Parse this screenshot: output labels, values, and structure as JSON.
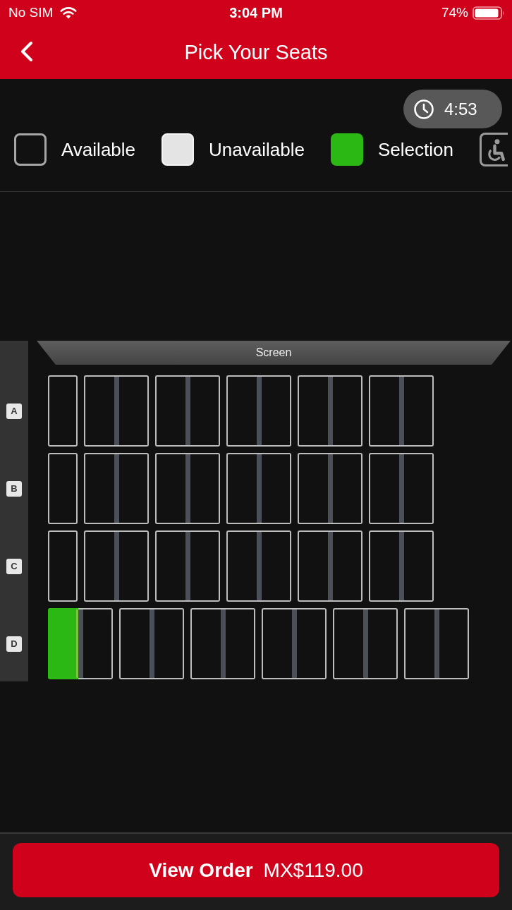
{
  "status_bar": {
    "carrier": "No SIM",
    "time": "3:04 PM",
    "battery": "74%"
  },
  "nav_bar": {
    "title": "Pick Your Seats"
  },
  "timer": {
    "time": "4:53"
  },
  "legend": [
    {
      "kind": "available",
      "label": "Available"
    },
    {
      "kind": "unavailable",
      "label": "Unavailable"
    },
    {
      "kind": "selection",
      "label": "Selection"
    },
    {
      "kind": "accessible"
    }
  ],
  "seat_map": {
    "screen_label": "Screen",
    "rows": [
      {
        "label": "A",
        "groups": [
          {
            "seats": [
              {
                "selected": false
              }
            ]
          },
          {
            "seats": [
              {
                "selected": false
              },
              {
                "selected": false
              }
            ]
          },
          {
            "seats": [
              {
                "selected": false
              },
              {
                "selected": false
              }
            ]
          },
          {
            "seats": [
              {
                "selected": false
              },
              {
                "selected": false
              }
            ]
          },
          {
            "seats": [
              {
                "selected": false
              },
              {
                "selected": false
              }
            ]
          },
          {
            "seats": [
              {
                "selected": false
              },
              {
                "selected": false
              }
            ]
          }
        ]
      },
      {
        "label": "B",
        "groups": [
          {
            "seats": [
              {
                "selected": false
              }
            ]
          },
          {
            "seats": [
              {
                "selected": false
              },
              {
                "selected": false
              }
            ]
          },
          {
            "seats": [
              {
                "selected": false
              },
              {
                "selected": false
              }
            ]
          },
          {
            "seats": [
              {
                "selected": false
              },
              {
                "selected": false
              }
            ]
          },
          {
            "seats": [
              {
                "selected": false
              },
              {
                "selected": false
              }
            ]
          },
          {
            "seats": [
              {
                "selected": false
              },
              {
                "selected": false
              }
            ]
          }
        ]
      },
      {
        "label": "C",
        "groups": [
          {
            "seats": [
              {
                "selected": false
              }
            ]
          },
          {
            "seats": [
              {
                "selected": false
              },
              {
                "selected": false
              }
            ]
          },
          {
            "seats": [
              {
                "selected": false
              },
              {
                "selected": false
              }
            ]
          },
          {
            "seats": [
              {
                "selected": false
              },
              {
                "selected": false
              }
            ]
          },
          {
            "seats": [
              {
                "selected": false
              },
              {
                "selected": false
              }
            ]
          },
          {
            "seats": [
              {
                "selected": false
              },
              {
                "selected": false
              }
            ]
          }
        ]
      },
      {
        "label": "D",
        "groups": [
          {
            "seats": [
              {
                "selected": true
              },
              {
                "selected": false
              }
            ]
          },
          {
            "seats": [
              {
                "selected": false
              },
              {
                "selected": false
              }
            ]
          },
          {
            "seats": [
              {
                "selected": false
              },
              {
                "selected": false
              }
            ]
          },
          {
            "seats": [
              {
                "selected": false
              },
              {
                "selected": false
              }
            ]
          },
          {
            "seats": [
              {
                "selected": false
              },
              {
                "selected": false
              }
            ]
          },
          {
            "seats": [
              {
                "selected": false
              },
              {
                "selected": false
              }
            ]
          }
        ]
      }
    ]
  },
  "order_button": {
    "label": "View Order",
    "total": "MX$119.00"
  }
}
